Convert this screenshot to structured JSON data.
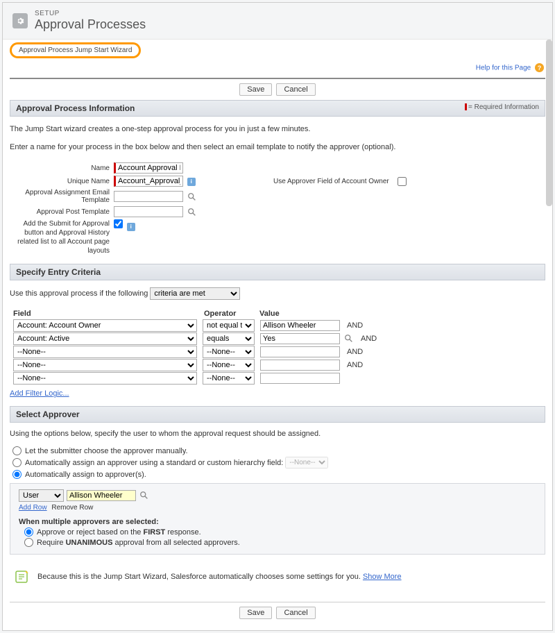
{
  "header": {
    "setup_label": "SETUP",
    "title": "Approval Processes"
  },
  "wizard_pill": "Approval Process Jump Start Wizard",
  "help_link": "Help for this Page",
  "buttons": {
    "save": "Save",
    "cancel": "Cancel"
  },
  "section_info": {
    "title": "Approval Process Information",
    "required": "= Required Information",
    "desc1": "The Jump Start wizard creates a one-step approval process for you in just a few minutes.",
    "desc2": "Enter a name for your process in the box below and then select an email template to notify the approver (optional).",
    "labels": {
      "name": "Name",
      "unique": "Unique Name",
      "email_tpl": "Approval Assignment Email Template",
      "post_tpl": "Approval Post Template",
      "add_submit": "Add the Submit for Approval button and Approval History related list to all Account page layouts",
      "use_approver": "Use Approver Field of Account Owner"
    },
    "values": {
      "name": "Account Approval Process",
      "unique": "Account_Approval_Proces"
    }
  },
  "section_criteria": {
    "title": "Specify Entry Criteria",
    "intro": "Use this approval process if the following",
    "criteria_met": "criteria are met",
    "headers": {
      "field": "Field",
      "operator": "Operator",
      "value": "Value"
    },
    "rows": [
      {
        "field": "Account: Account Owner",
        "op": "not equal to",
        "val": "Allison Wheeler",
        "and": "AND",
        "lookup": false
      },
      {
        "field": "Account: Active",
        "op": "equals",
        "val": "Yes",
        "and": "AND",
        "lookup": true
      },
      {
        "field": "--None--",
        "op": "--None--",
        "val": "",
        "and": "AND",
        "lookup": false
      },
      {
        "field": "--None--",
        "op": "--None--",
        "val": "",
        "and": "AND",
        "lookup": false
      },
      {
        "field": "--None--",
        "op": "--None--",
        "val": "",
        "and": "",
        "lookup": false
      }
    ],
    "add_filter": "Add Filter Logic..."
  },
  "section_approver": {
    "title": "Select Approver",
    "desc": "Using the options below, specify the user to whom the approval request should be assigned.",
    "opt_manual": "Let the submitter choose the approver manually.",
    "opt_hierarchy": "Automatically assign an approver using a standard or custom hierarchy field:",
    "hierarchy_placeholder": "--None--",
    "opt_auto": "Automatically assign to approver(s).",
    "user_type": "User",
    "user_name": "Allison Wheeler",
    "add_row": "Add Row",
    "remove_row": "Remove Row",
    "mult_header": "When multiple approvers are selected:",
    "resp_first_pre": "Approve or reject based on the ",
    "resp_first_bold": "FIRST",
    "resp_first_post": " response.",
    "resp_unan_pre": "Require ",
    "resp_unan_bold": "UNANIMOUS",
    "resp_unan_post": " approval from all selected approvers."
  },
  "note": {
    "text": "Because this is the Jump Start Wizard, Salesforce automatically chooses some settings for you. ",
    "show_more": "Show More"
  }
}
